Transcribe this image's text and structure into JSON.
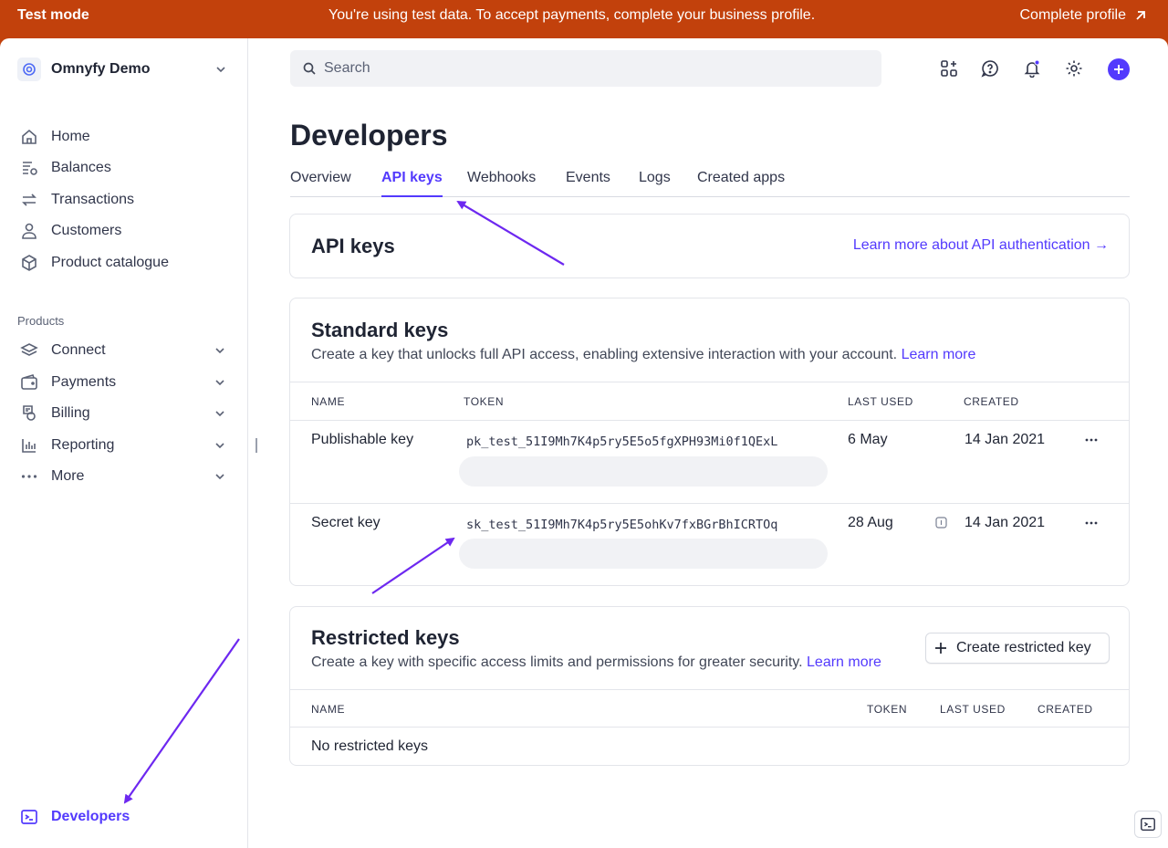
{
  "banner": {
    "mode": "Test mode",
    "message": "You're using test data. To accept payments, complete your business profile.",
    "cta": "Complete profile"
  },
  "sidebar": {
    "account": "Omnyfy Demo",
    "items": [
      {
        "label": "Home",
        "icon": "home-icon"
      },
      {
        "label": "Balances",
        "icon": "balances-icon"
      },
      {
        "label": "Transactions",
        "icon": "transactions-icon"
      },
      {
        "label": "Customers",
        "icon": "customers-icon"
      },
      {
        "label": "Product catalogue",
        "icon": "product-catalogue-icon"
      }
    ],
    "products_label": "Products",
    "products": [
      {
        "label": "Connect",
        "icon": "connect-icon"
      },
      {
        "label": "Payments",
        "icon": "payments-icon"
      },
      {
        "label": "Billing",
        "icon": "billing-icon"
      },
      {
        "label": "Reporting",
        "icon": "reporting-icon"
      },
      {
        "label": "More",
        "icon": "more-icon"
      }
    ],
    "developers": "Developers"
  },
  "search": {
    "placeholder": "Search"
  },
  "page": {
    "title": "Developers",
    "tabs": [
      "Overview",
      "API keys",
      "Webhooks",
      "Events",
      "Logs",
      "Created apps"
    ],
    "active_tab": "API keys"
  },
  "api_keys_card": {
    "title": "API keys",
    "link": "Learn more about API authentication →"
  },
  "standard_keys": {
    "title": "Standard keys",
    "description": "Create a key that unlocks full API access, enabling extensive interaction with your account.",
    "learn_more": "Learn more",
    "columns": {
      "name": "NAME",
      "token": "TOKEN",
      "last_used": "LAST USED",
      "created": "CREATED"
    },
    "rows": [
      {
        "name": "Publishable key",
        "token": "pk_test_51I9Mh7K4p5ry5E5o5fgXPH93Mi0f1QExL",
        "last_used": "6 May",
        "created": "14 Jan 2021"
      },
      {
        "name": "Secret key",
        "token": "sk_test_51I9Mh7K4p5ry5E5ohKv7fxBGrBhICRTOq",
        "last_used": "28 Aug",
        "created": "14 Jan 2021"
      }
    ]
  },
  "restricted_keys": {
    "title": "Restricted keys",
    "description": "Create a key with specific access limits and permissions for greater security.",
    "learn_more": "Learn more",
    "create_button": "Create restricted key",
    "columns": {
      "name": "NAME",
      "token": "TOKEN",
      "last_used": "LAST USED",
      "created": "CREATED"
    },
    "empty": "No restricted keys"
  },
  "colors": {
    "accent": "#533afd",
    "banner": "#c2410c",
    "annotation_arrow": "#6d28f0"
  }
}
